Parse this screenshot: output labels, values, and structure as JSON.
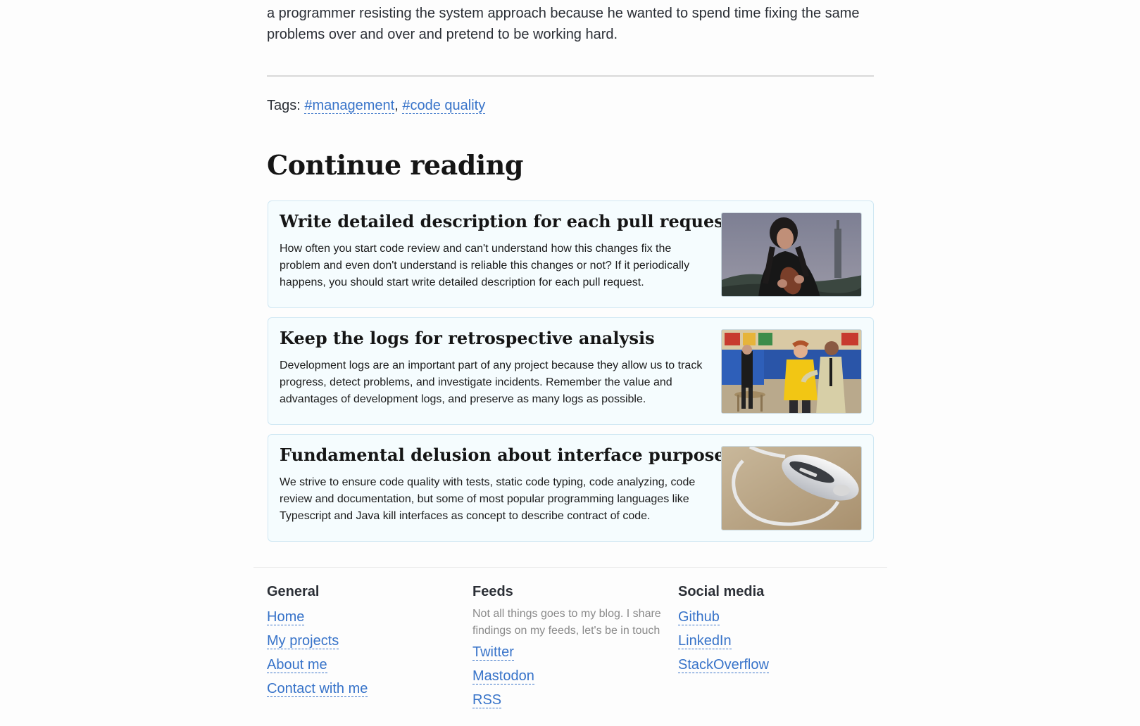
{
  "article": {
    "intro_line1": "a programmer resisting the system approach because he wanted to spend time fixing the same",
    "intro_line2": "problems over and over and pretend to be working hard."
  },
  "tags": {
    "label": "Tags:",
    "separator": ",",
    "items": [
      "#management",
      "#code quality"
    ]
  },
  "continue_reading": {
    "heading": "Continue reading",
    "cards": [
      {
        "title": "Write detailed description for each pull request",
        "description": "How often you start code review and can't understand how this changes fix the problem and even don't understand is reliable this changes or not? If it periodically happens, you should start write detailed description for each pull request.",
        "image_icon": "man-holding-football-photo"
      },
      {
        "title": "Keep the logs for retrospective analysis",
        "description": "Development logs are an important part of any project because they allow us to track progress, detect problems, and investigate incidents. Remember the value and advantages of development logs, and preserve as many logs as possible.",
        "image_icon": "restaurant-scene-photo"
      },
      {
        "title": "Fundamental delusion about interface purposes",
        "description": "We strive to ensure code quality with tests, static code typing, code analyzing, code review and documentation, but some of most popular programming languages like Typescript and Java kill interfaces as concept to describe contract of code.",
        "image_icon": "magic-mouse-charging-photo"
      }
    ]
  },
  "footer": {
    "general": {
      "title": "General",
      "links": [
        "Home",
        "My projects",
        "About me",
        "Contact with me"
      ]
    },
    "feeds": {
      "title": "Feeds",
      "note": "Not all things goes to my blog. I share findings on my feeds, let's be in touch",
      "links": [
        "Twitter",
        "Mastodon",
        "RSS"
      ]
    },
    "social": {
      "title": "Social media",
      "links": [
        "Github",
        "LinkedIn",
        "StackOverflow"
      ]
    }
  },
  "colors": {
    "link": "#3773c9",
    "card_background": "#f5fcfe",
    "card_border": "#cfe7f3"
  }
}
